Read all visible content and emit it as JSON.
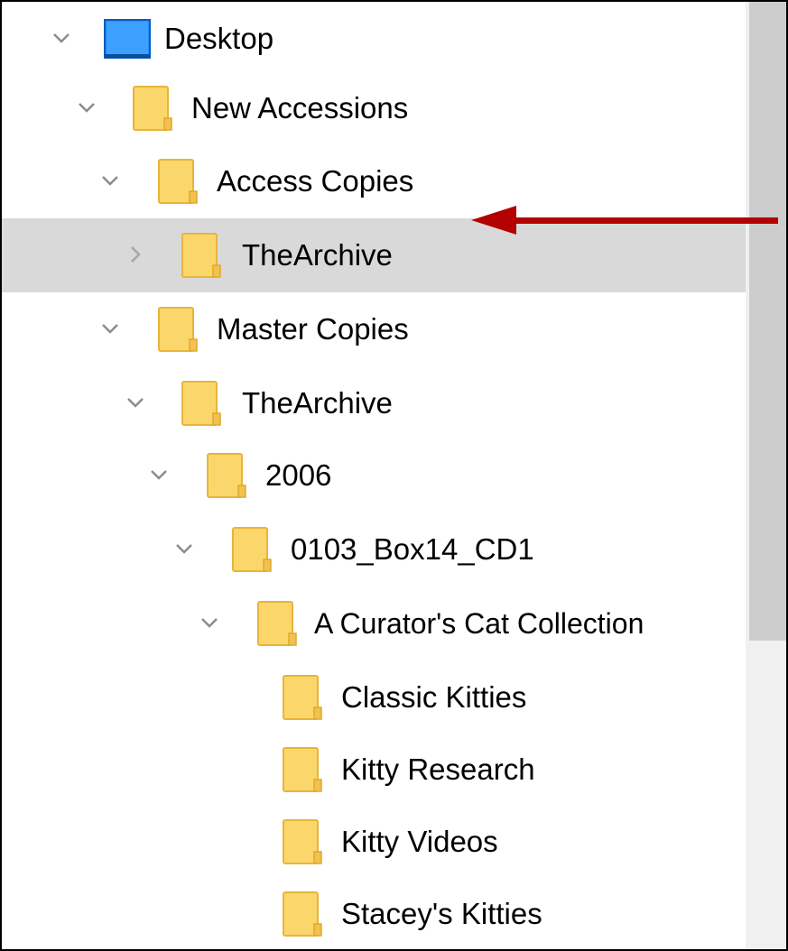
{
  "tree": {
    "items": [
      {
        "label": "Desktop",
        "icon": "desktop-icon",
        "expanded": true
      },
      {
        "label": "New Accessions",
        "icon": "folder-icon",
        "expanded": true
      },
      {
        "label": "Access Copies",
        "icon": "folder-icon",
        "expanded": true
      },
      {
        "label": "TheArchive",
        "icon": "folder-icon",
        "expanded": false,
        "selected": true
      },
      {
        "label": "Master Copies",
        "icon": "folder-icon",
        "expanded": true
      },
      {
        "label": "TheArchive",
        "icon": "folder-icon",
        "expanded": true
      },
      {
        "label": "2006",
        "icon": "folder-icon",
        "expanded": true
      },
      {
        "label": "0103_Box14_CD1",
        "icon": "folder-icon",
        "expanded": true
      },
      {
        "label": "A Curator's Cat Collection",
        "icon": "folder-icon",
        "expanded": true
      },
      {
        "label": "Classic Kitties",
        "icon": "folder-icon"
      },
      {
        "label": "Kitty Research",
        "icon": "folder-icon"
      },
      {
        "label": "Kitty Videos",
        "icon": "folder-icon"
      },
      {
        "label": "Stacey's Kitties",
        "icon": "folder-icon"
      }
    ]
  },
  "annotation": {
    "icon": "red-arrow-icon",
    "color": "#b30000"
  },
  "colors": {
    "selected_row": "#d9d9d9",
    "folder_fill": "#fbd66b",
    "folder_edge": "#e8b43a",
    "desktop_fill": "#1e90ff",
    "scrollbar_track": "#f0f0f0",
    "scrollbar_thumb": "#cdcdcd",
    "chevron": "#a6a6a6"
  }
}
